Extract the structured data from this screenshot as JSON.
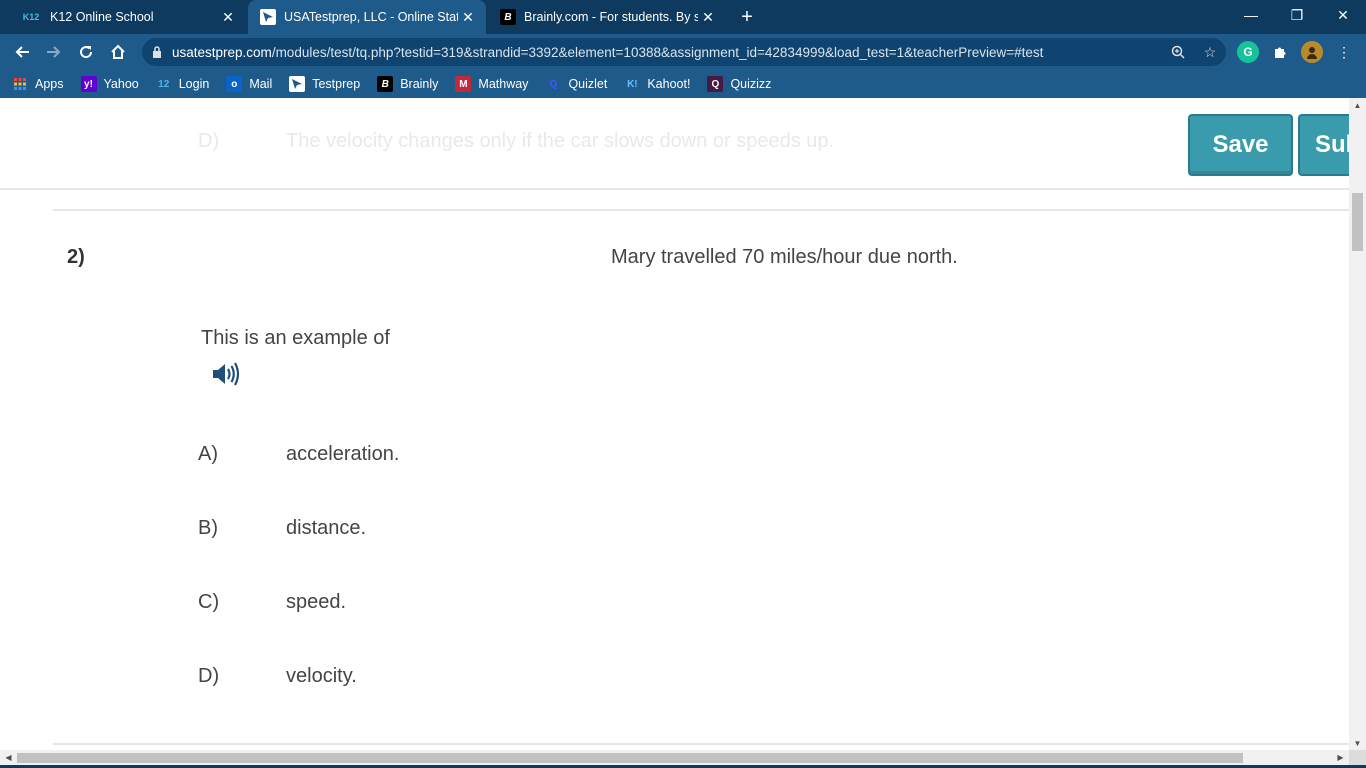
{
  "browser": {
    "tabs": [
      {
        "favicon": "K12",
        "title": "K12 Online School",
        "active": false
      },
      {
        "favicon": "usatestprep-icon",
        "title": "USATestprep, LLC - Online State-Sp",
        "active": true
      },
      {
        "favicon": "B",
        "title": "Brainly.com - For students. By stud",
        "active": false
      }
    ],
    "new_tab": "+",
    "window": {
      "minimize": "—",
      "restore": "❐",
      "close": "✕"
    },
    "address": {
      "host": "usatestprep.com",
      "path": "/modules/test/tq.php?testid=319&strandid=3392&element=10388&assignment_id=42834999&load_test=1&teacherPreview=#test"
    },
    "bookmarks": [
      {
        "icon": "apps-icon",
        "label": "Apps"
      },
      {
        "icon": "y!",
        "label": "Yahoo"
      },
      {
        "icon": "12",
        "label": "Login"
      },
      {
        "icon": "mail-icon",
        "label": "Mail"
      },
      {
        "icon": "testprep-icon",
        "label": "Testprep"
      },
      {
        "icon": "B",
        "label": "Brainly"
      },
      {
        "icon": "M",
        "label": "Mathway"
      },
      {
        "icon": "Q",
        "label": "Quizlet"
      },
      {
        "icon": "K!",
        "label": "Kahoot!"
      },
      {
        "icon": "Q",
        "label": "Quizizz"
      }
    ]
  },
  "page": {
    "previous_choice": {
      "letter": "D)",
      "text": "The velocity changes only if the car slows down or speeds up."
    },
    "save_label": "Save",
    "submit_label": "Sub",
    "question": {
      "number": "2)",
      "stimulus": "Mary travelled 70 miles/hour due north.",
      "stem": "This is an example of",
      "choices": [
        {
          "letter": "A)",
          "text": "acceleration."
        },
        {
          "letter": "B)",
          "text": "distance."
        },
        {
          "letter": "C)",
          "text": "speed."
        },
        {
          "letter": "D)",
          "text": "velocity."
        }
      ]
    }
  },
  "colors": {
    "tabstrip": "#0d3a5e",
    "toolbar": "#1e5b8a",
    "button": "#3a9bac",
    "text": "#444444"
  }
}
